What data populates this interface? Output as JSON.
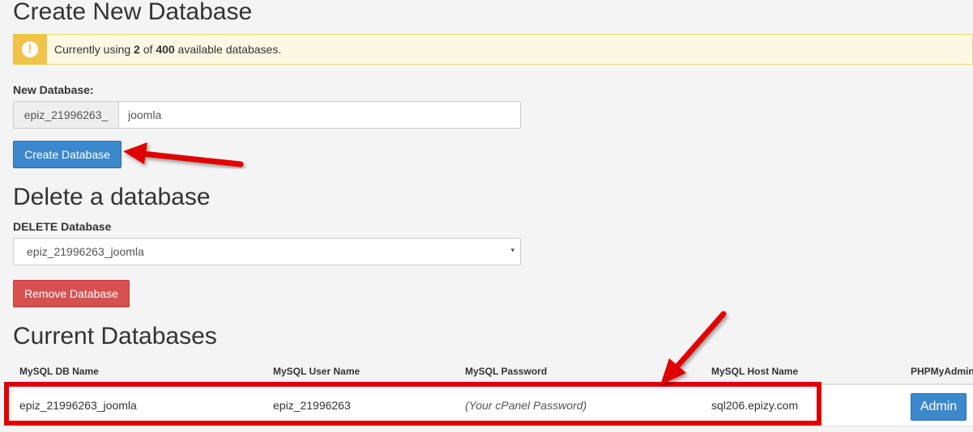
{
  "sections": {
    "create_title": "Create New Database",
    "delete_title": "Delete a database",
    "current_title": "Current Databases"
  },
  "alert": {
    "icon": "exclamation-icon",
    "text_before": "Currently using ",
    "used": "2",
    "text_middle": " of ",
    "total": "400",
    "text_after": " available databases."
  },
  "new_database": {
    "label": "New Database:",
    "prefix": "epiz_21996263_",
    "value": "joomla",
    "button": "Create Database"
  },
  "delete_database": {
    "label": "DELETE Database",
    "selected": "epiz_21996263_joomla",
    "caret": "▾",
    "button": "Remove Database"
  },
  "table": {
    "headers": [
      "MySQL DB Name",
      "MySQL User Name",
      "MySQL Password",
      "MySQL Host Name",
      "PHPMyAdmin"
    ],
    "rows": [
      {
        "db_name": "epiz_21996263_joomla",
        "user_name": "epiz_21996263",
        "password": "(Your cPanel Password)",
        "host": "sql206.epizy.com",
        "admin_button": "Admin"
      }
    ]
  },
  "colors": {
    "primary": "#3c88cd",
    "danger": "#d65050",
    "warning": "#f2c34a",
    "annotation": "#e00000"
  }
}
